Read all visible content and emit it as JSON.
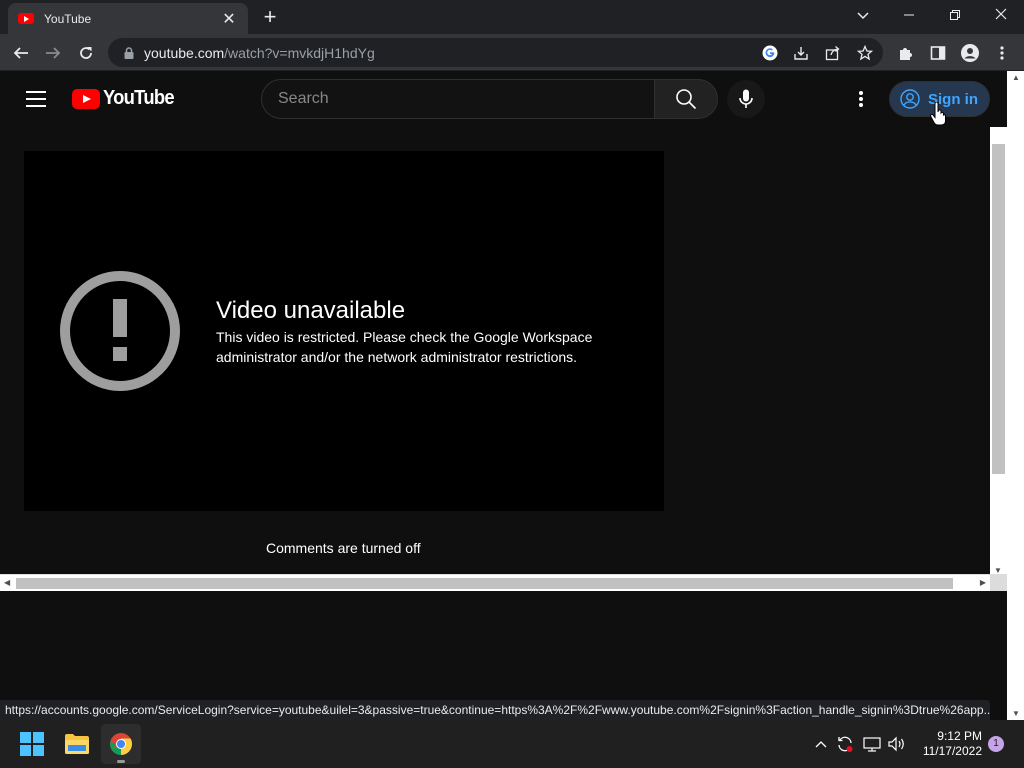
{
  "browser": {
    "tab": {
      "title": "YouTube"
    },
    "url": {
      "host": "youtube.com",
      "path": "/watch?v=mvkdjH1hdYg"
    }
  },
  "youtube": {
    "search": {
      "placeholder": "Search"
    },
    "sign_in_label": "Sign in",
    "player": {
      "error_title": "Video unavailable",
      "error_message": "This video is restricted. Please check the Google Workspace administrator and/or the network administrator restrictions."
    },
    "comments_status": "Comments are turned off"
  },
  "status_bar": {
    "link": "https://accounts.google.com/ServiceLogin?service=youtube&uilel=3&passive=true&continue=https%3A%2F%2Fwww.youtube.com%2Fsignin%3Faction_handle_signin%3Dtrue%26app..."
  },
  "taskbar": {
    "time": "9:12 PM",
    "date": "11/17/2022",
    "notification_count": "1"
  },
  "colors": {
    "brand_red": "#ff0000",
    "link_blue": "#3ea6ff",
    "page_bg": "#0f0f0f"
  }
}
